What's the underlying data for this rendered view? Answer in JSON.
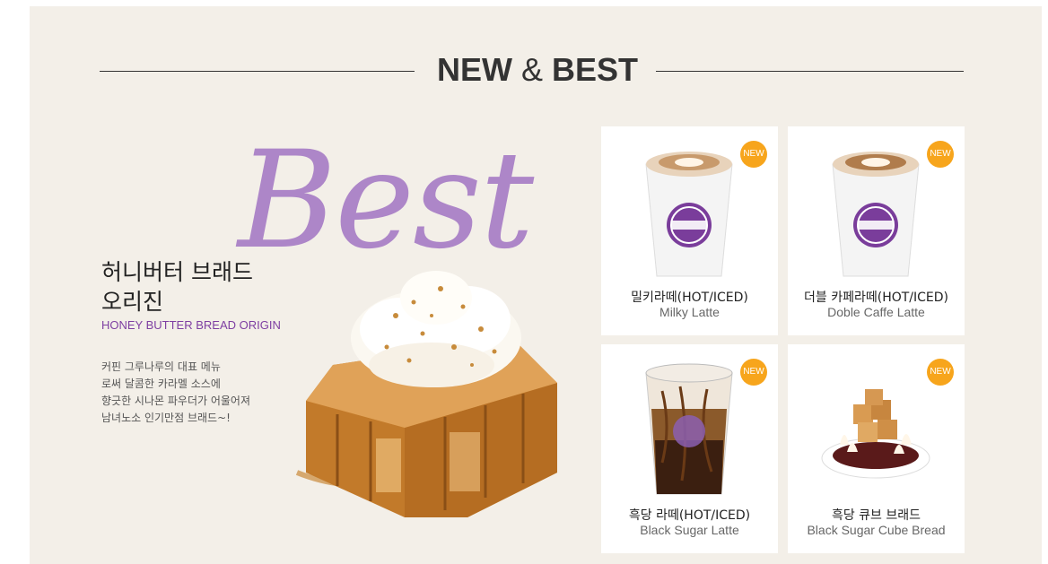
{
  "section": {
    "title_bold_1": "NEW",
    "title_amp": "&",
    "title_bold_2": "BEST"
  },
  "feature": {
    "badge_word": "Best",
    "title": "허니버터 브래드\n오리진",
    "subtitle": "HONEY BUTTER BREAD ORIGIN",
    "description": "커핀 그루나루의 대표 메뉴\n로써 달콤한 카라멜 소스에\n향긋한 시나몬 파우더가 어울어져\n남녀노소 인기만점 브래드~!"
  },
  "products": [
    {
      "name_ko": "밀키라떼(HOT/ICED)",
      "name_en": "Milky Latte",
      "badge": "NEW"
    },
    {
      "name_ko": "더블 카페라떼(HOT/ICED)",
      "name_en": "Doble Caffe Latte",
      "badge": "NEW"
    },
    {
      "name_ko": "흑당 라떼(HOT/ICED)",
      "name_en": "Black Sugar Latte",
      "badge": "NEW"
    },
    {
      "name_ko": "흑당 큐브 브래드",
      "name_en": "Black Sugar Cube Bread",
      "badge": "NEW"
    }
  ],
  "colors": {
    "background": "#f3efe8",
    "accent_purple": "#ad86c8",
    "subtitle_purple": "#7e3fa2",
    "badge_orange": "#f7a51c"
  }
}
